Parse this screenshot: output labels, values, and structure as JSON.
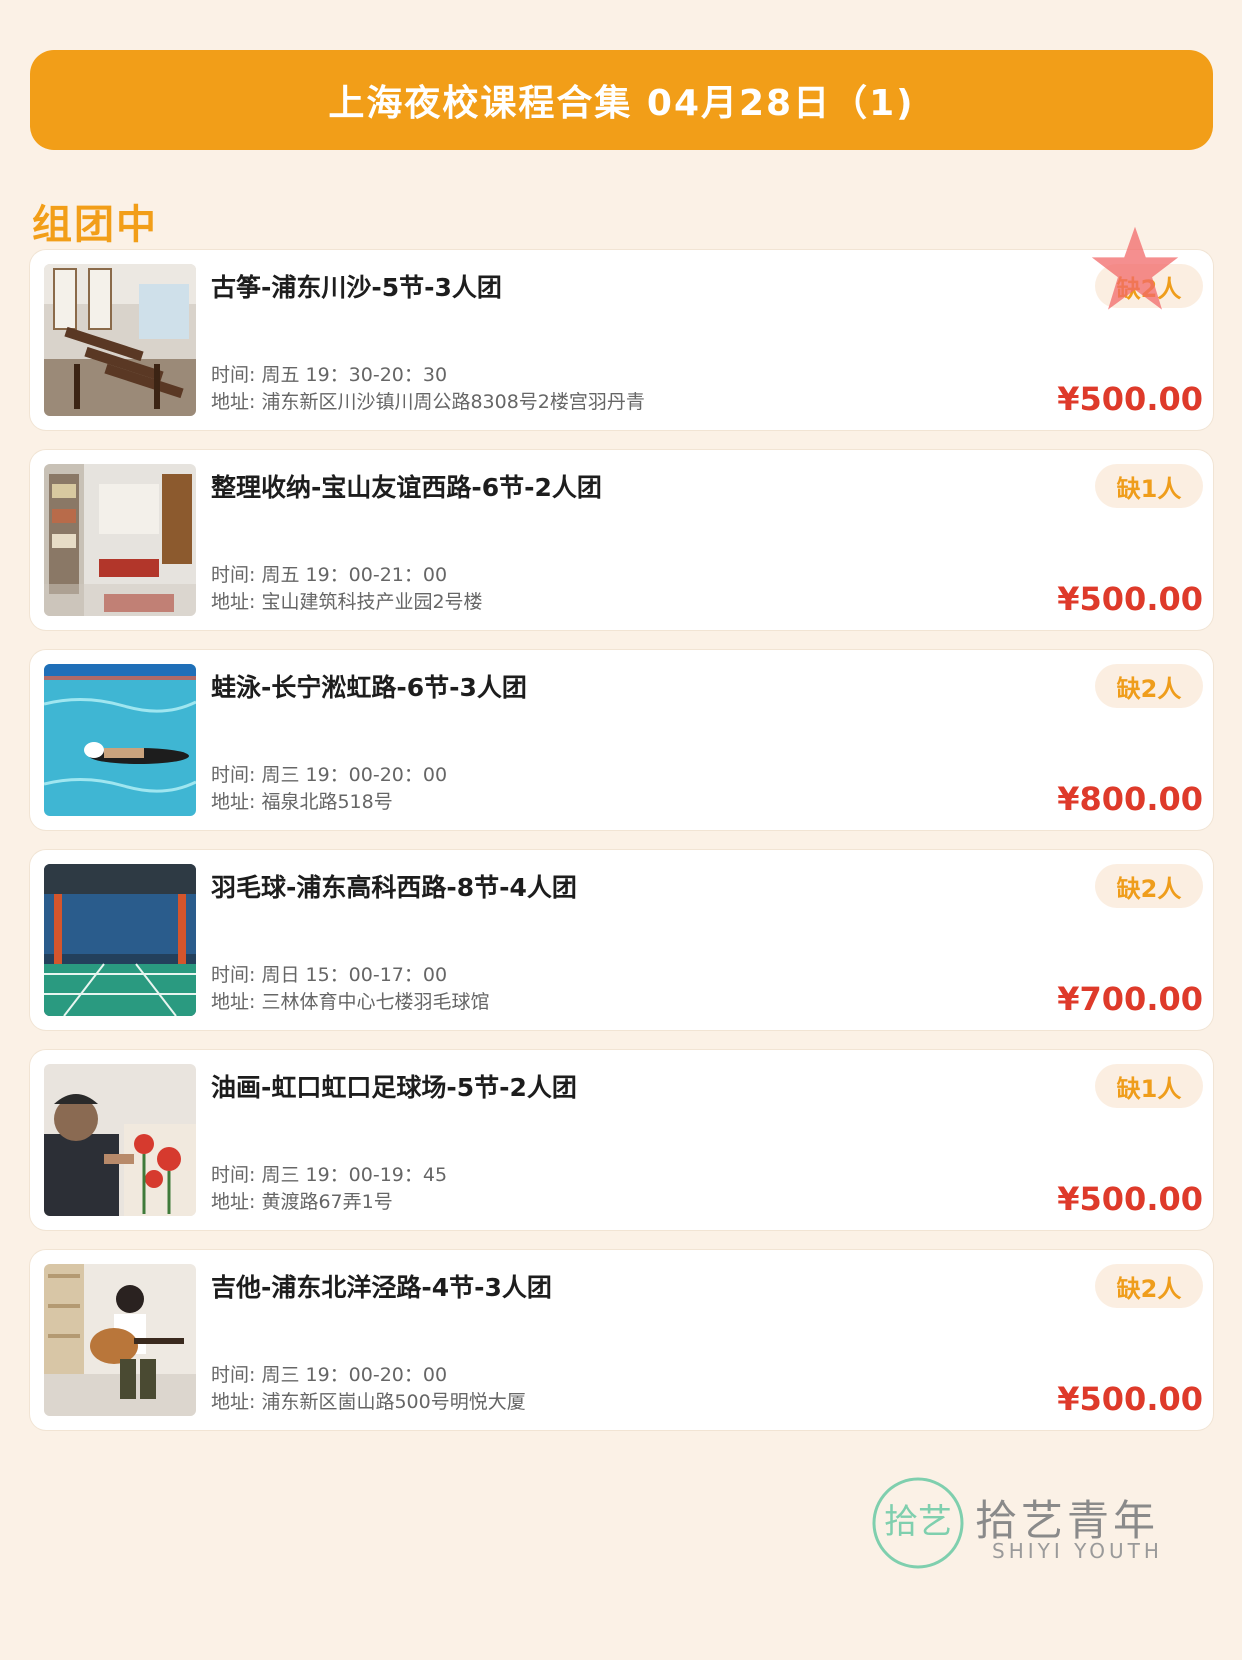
{
  "banner": {
    "title": "上海夜校课程合集 04月28日（1)"
  },
  "section": {
    "title": "组团中"
  },
  "courses": [
    {
      "title": "古筝-浦东川沙-5节-3人团",
      "time": "时间: 周五 19：30-20：30",
      "address": "地址: 浦东新区川沙镇川周公路8308号2楼宫羽丹青",
      "badge": "缺2人",
      "price": "¥500.00",
      "photo": "guzheng-room-photo"
    },
    {
      "title": "整理收纳-宝山友谊西路-6节-2人团",
      "time": "时间: 周五 19：00-21：00",
      "address": "地址: 宝山建筑科技产业园2号楼",
      "badge": "缺1人",
      "price": "¥500.00",
      "photo": "storage-classroom-photo"
    },
    {
      "title": "蛙泳-长宁淞虹路-6节-3人团",
      "time": "时间: 周三 19：00-20：00",
      "address": "地址: 福泉北路518号",
      "badge": "缺2人",
      "price": "¥800.00",
      "photo": "swimming-pool-photo"
    },
    {
      "title": "羽毛球-浦东高科西路-8节-4人团",
      "time": "时间: 周日 15：00-17：00",
      "address": "地址: 三林体育中心七楼羽毛球馆",
      "badge": "缺2人",
      "price": "¥700.00",
      "photo": "badminton-court-photo"
    },
    {
      "title": "油画-虹口虹口足球场-5节-2人团",
      "time": "时间: 周三 19：00-19：45",
      "address": "地址: 黄渡路67弄1号",
      "badge": "缺1人",
      "price": "¥500.00",
      "photo": "oil-painting-photo"
    },
    {
      "title": "吉他-浦东北洋泾路-4节-3人团",
      "time": "时间: 周三 19：00-20：00",
      "address": "地址: 浦东新区崮山路500号明悦大厦",
      "badge": "缺2人",
      "price": "¥500.00",
      "photo": "guitar-player-photo"
    }
  ],
  "logo": {
    "mark": "拾艺",
    "name_cn": "拾艺青年",
    "name_en": "SHIYI YOUTH"
  },
  "colors": {
    "accent": "#f29e18",
    "price": "#de3a2a",
    "background": "#fbf1e6"
  }
}
